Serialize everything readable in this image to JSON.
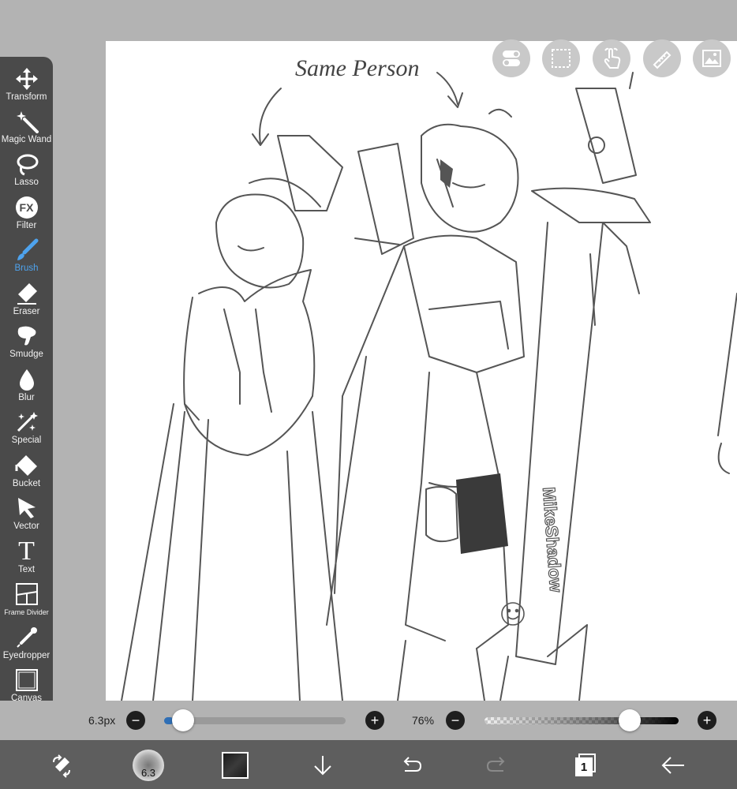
{
  "toolbar": {
    "active_color": "#4ea3ee",
    "tools": [
      {
        "label": "Transform",
        "icon": "move-arrows-icon"
      },
      {
        "label": "Magic Wand",
        "icon": "magic-wand-icon"
      },
      {
        "label": "Lasso",
        "icon": "lasso-icon"
      },
      {
        "label": "Filter",
        "icon": "fx-icon",
        "icon_text": "FX"
      },
      {
        "label": "Brush",
        "icon": "brush-icon",
        "active": true
      },
      {
        "label": "Eraser",
        "icon": "eraser-icon"
      },
      {
        "label": "Smudge",
        "icon": "smudge-icon"
      },
      {
        "label": "Blur",
        "icon": "blur-drop-icon"
      },
      {
        "label": "Special",
        "icon": "sparkle-icon"
      },
      {
        "label": "Bucket",
        "icon": "bucket-icon"
      },
      {
        "label": "Vector",
        "icon": "cursor-arrow-icon"
      },
      {
        "label": "Text",
        "icon": "text-t-icon",
        "icon_text": "T"
      },
      {
        "label": "Frame Divider",
        "icon": "frame-divider-icon"
      },
      {
        "label": "Eyedropper",
        "icon": "eyedropper-icon"
      },
      {
        "label": "Canvas",
        "icon": "canvas-square-icon"
      }
    ]
  },
  "floating_buttons": [
    {
      "icon": "toggle-switch-icon"
    },
    {
      "icon": "dashed-selection-icon"
    },
    {
      "icon": "touch-hand-icon"
    },
    {
      "icon": "ruler-pencil-icon"
    },
    {
      "icon": "image-icon"
    }
  ],
  "canvas": {
    "annotation_text": "Same Person",
    "sword_text": "MikeShadow"
  },
  "brush_size": {
    "value_label": "6.3px",
    "minus": "−",
    "plus": "+",
    "level": 0.05
  },
  "opacity": {
    "value_label": "76%",
    "minus": "−",
    "plus": "+",
    "level": 0.76
  },
  "bottom_bar": {
    "brush_preview_value": "6.3",
    "layer_count": "1",
    "buttons": [
      {
        "icon": "swap-transform-icon"
      },
      {
        "icon": "brush-preview-icon"
      },
      {
        "icon": "color-swatch-icon"
      },
      {
        "icon": "download-arrow-icon"
      },
      {
        "icon": "undo-icon"
      },
      {
        "icon": "redo-icon"
      },
      {
        "icon": "layers-icon"
      },
      {
        "icon": "back-arrow-icon"
      }
    ]
  }
}
